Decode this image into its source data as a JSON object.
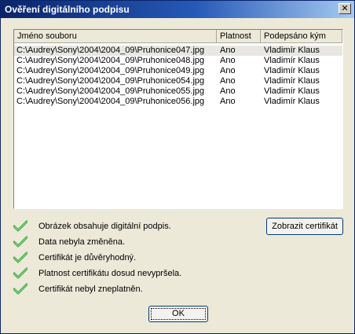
{
  "window": {
    "title": "Ověření digitálního podpisu"
  },
  "titlebar": {
    "close_glyph": "✕"
  },
  "list": {
    "columns": [
      "Jméno souboru",
      "Platnost",
      "Podepsáno kým"
    ],
    "rows": [
      [
        "C:\\Audrey\\Sony\\2004\\2004_09\\Pruhonice047.jpg",
        "Ano",
        "Vladimír Klaus"
      ],
      [
        "C:\\Audrey\\Sony\\2004\\2004_09\\Pruhonice048.jpg",
        "Ano",
        "Vladimír Klaus"
      ],
      [
        "C:\\Audrey\\Sony\\2004\\2004_09\\Pruhonice049.jpg",
        "Ano",
        "Vladimír Klaus"
      ],
      [
        "C:\\Audrey\\Sony\\2004\\2004_09\\Pruhonice054.jpg",
        "Ano",
        "Vladimír Klaus"
      ],
      [
        "C:\\Audrey\\Sony\\2004\\2004_09\\Pruhonice055.jpg",
        "Ano",
        "Vladimír Klaus"
      ],
      [
        "C:\\Audrey\\Sony\\2004\\2004_09\\Pruhonice056.jpg",
        "Ano",
        "Vladimír Klaus"
      ]
    ]
  },
  "status": {
    "icon": "green-check-icon",
    "items": [
      "Obrázek obsahuje digitální podpis.",
      "Data nebyla změněna.",
      "Certifikát je důvěryhodný.",
      "Platnost certifikátu dosud nevypršela.",
      "Certifikát nebyl zneplatněn."
    ]
  },
  "buttons": {
    "show_certificate": "Zobrazit certifikát",
    "ok": "OK"
  },
  "colors": {
    "titlebar": "#0a246a",
    "dialog_bg": "#ece9d8",
    "check": "#3aa53a"
  }
}
